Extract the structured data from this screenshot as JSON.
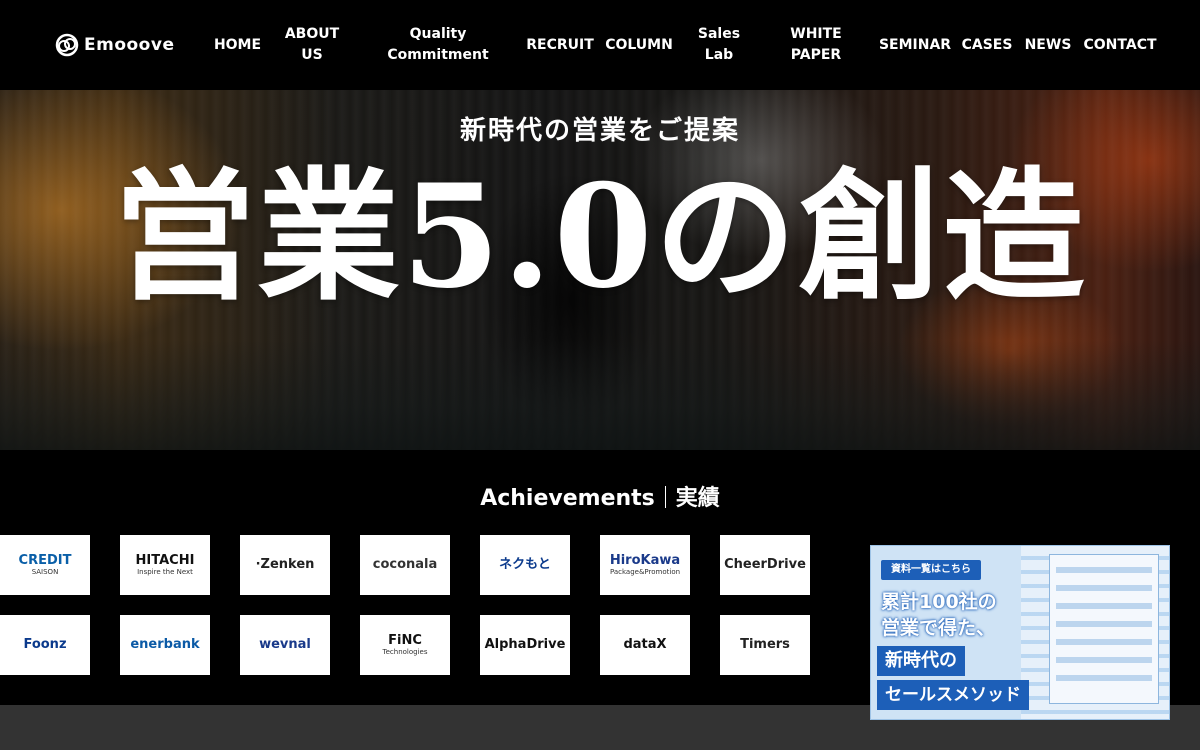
{
  "header": {
    "logo_text": "Emooove",
    "nav": [
      {
        "label": "HOME"
      },
      {
        "label": "ABOUT\nUS"
      },
      {
        "label": "Quality\nCommitment"
      },
      {
        "label": "RECRUIT"
      },
      {
        "label": "COLUMN"
      },
      {
        "label": "Sales\nLab"
      },
      {
        "label": "WHITE\nPAPER"
      },
      {
        "label": "SEMINAR"
      },
      {
        "label": "CASES"
      },
      {
        "label": "NEWS"
      },
      {
        "label": "CONTACT"
      }
    ]
  },
  "hero": {
    "subtitle": "新時代の営業をご提案",
    "title": "営業5.0の創造"
  },
  "achievements": {
    "heading_en": "Achievements",
    "heading_ja": "実績",
    "row1": [
      {
        "name": "CREDIT SAISON",
        "line1": "CREDIT",
        "line2": "SAISON",
        "color": "#0a5fa8"
      },
      {
        "name": "HITACHI",
        "line1": "HITACHI",
        "line2": "Inspire the Next",
        "color": "#111111"
      },
      {
        "name": "Zenken",
        "line1": "·Zenken",
        "line2": "",
        "color": "#222222"
      },
      {
        "name": "coconala",
        "line1": "coconala",
        "line2": "",
        "color": "#333333"
      },
      {
        "name": "ネクもと",
        "line1": "ネクもと",
        "line2": "",
        "color": "#0b3a8c"
      },
      {
        "name": "HiroKawa",
        "line1": "HiroKawa",
        "line2": "Package&Promotion",
        "color": "#1a3a8a"
      },
      {
        "name": "CheerDrive",
        "line1": "CheerDrive",
        "line2": "",
        "color": "#222222"
      }
    ],
    "row2": [
      {
        "name": "Foonz",
        "line1": "Foonz",
        "line2": "",
        "color": "#0b3a8c"
      },
      {
        "name": "enerbank",
        "line1": "enerbank",
        "line2": "",
        "color": "#0b5aa6"
      },
      {
        "name": "wevnal",
        "line1": "wevnal",
        "line2": "",
        "color": "#1a3a8a"
      },
      {
        "name": "FiNC Technologies",
        "line1": "FiNC",
        "line2": "Technologies",
        "color": "#111111"
      },
      {
        "name": "AlphaDrive",
        "line1": "AlphaDrive",
        "line2": "",
        "color": "#111111"
      },
      {
        "name": "dataX",
        "line1": "dataX",
        "line2": "",
        "color": "#111111"
      },
      {
        "name": "Timers",
        "line1": "Timers",
        "line2": "",
        "color": "#222222"
      }
    ]
  },
  "banner": {
    "tag": "資料一覧はこちら",
    "line1": "累計100社の",
    "line2": "営業で得た、",
    "box1": "新時代の",
    "box2": "セールスメソッド"
  },
  "colors": {
    "header_bg": "#000000",
    "band": "#333333",
    "banner_blue": "#1d5fb8"
  }
}
